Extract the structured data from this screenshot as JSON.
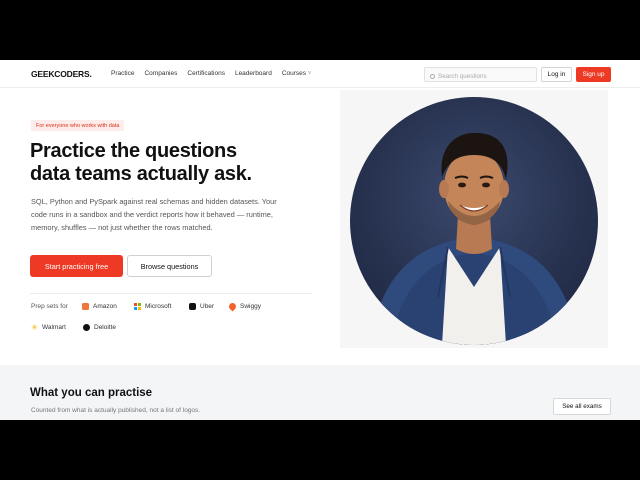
{
  "nav": {
    "logo": "GEEKCODERS",
    "logo_dot": ".",
    "links": [
      "Practice",
      "Companies",
      "Certifications",
      "Leaderboard",
      "Courses"
    ],
    "courses_caret": "˅",
    "search_placeholder": "Search questions",
    "login_label": "Log in",
    "signup_label": "Sign up"
  },
  "hero": {
    "tag": "For everyone who works with data",
    "headline_line1": "Practice the questions",
    "headline_line2": "data teams actually ask.",
    "description": "SQL, Python and PySpark against real schemas and hidden datasets. Your code runs in a sandbox and the verdict reports how it behaved — runtime, memory, shuffles — not just whether the rows matched.",
    "primary_button": "Start practicing free",
    "secondary_button": "Browse questions",
    "prep_label": "Prep sets for",
    "companies": [
      "Amazon",
      "Microsoft",
      "Uber",
      "Swiggy",
      "Walmart",
      "Deloitte"
    ]
  },
  "section": {
    "title": "What you can practise",
    "subtitle": "Counted from what is actually published, not a list of logos.",
    "see_all": "See all exams"
  },
  "colors": {
    "accent": "#ee3a24",
    "tag_bg": "#fdecea",
    "photo_bg": "#27324f"
  }
}
